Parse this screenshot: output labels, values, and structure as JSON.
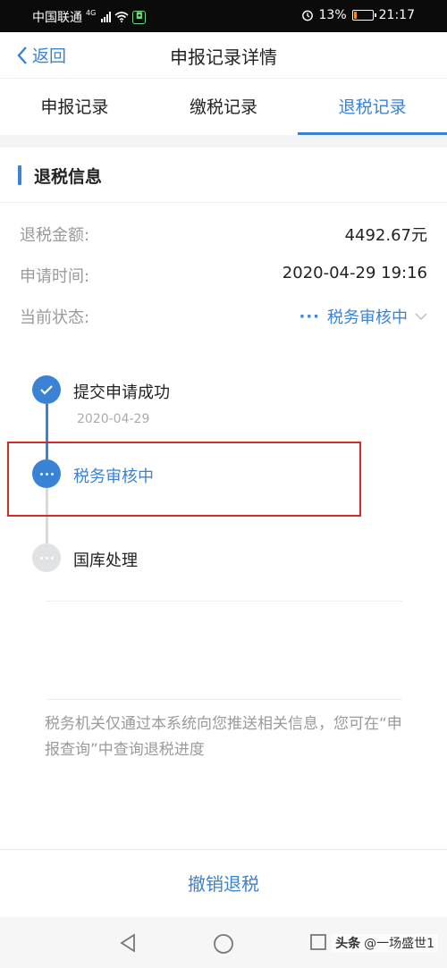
{
  "status_bar": {
    "carrier": "中国联通",
    "network": "4G",
    "battery": "13%",
    "battery_level": 0.13,
    "time": "21:17"
  },
  "header": {
    "back_label": "返回",
    "title": "申报记录详情"
  },
  "tabs": [
    {
      "label": "申报记录",
      "active": false
    },
    {
      "label": "缴税记录",
      "active": false
    },
    {
      "label": "退税记录",
      "active": true
    }
  ],
  "section": {
    "title": "退税信息"
  },
  "info": {
    "amount_label": "退税金额:",
    "amount_value": "4492.67元",
    "time_label": "申请时间:",
    "time_value": "2020-04-29 19:16",
    "status_label": "当前状态:",
    "status_value": "税务审核中"
  },
  "timeline": [
    {
      "label": "提交申请成功",
      "date": "2020-04-29",
      "state": "done"
    },
    {
      "label": "税务审核中",
      "date": "",
      "state": "current"
    },
    {
      "label": "国库处理",
      "date": "",
      "state": "pending"
    }
  ],
  "notice": "税务机关仅通过本系统向您推送相关信息，您可在“申报查询”中查询退税进度",
  "bottom_action": "撤销退税",
  "watermark": {
    "logo": "头条",
    "text": "@一场盛世1"
  },
  "colors": {
    "accent": "#3a83d4",
    "highlight": "#d62a2a"
  }
}
